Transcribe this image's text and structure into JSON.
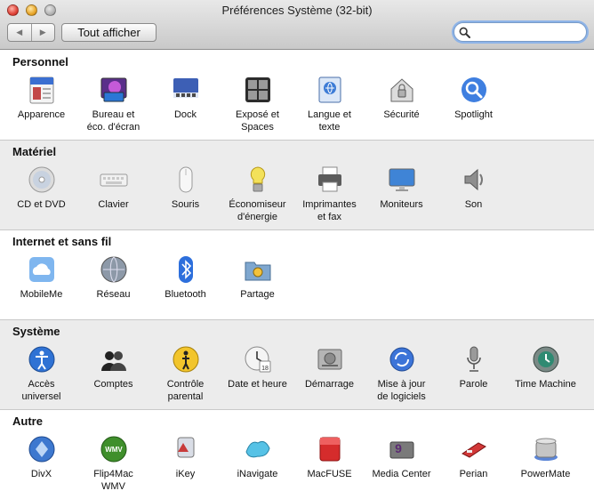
{
  "window": {
    "title": "Préférences Système (32-bit)"
  },
  "toolbar": {
    "back_label": "◀",
    "forward_label": "▶",
    "show_all_label": "Tout afficher",
    "search_value": "",
    "search_placeholder": ""
  },
  "sections": [
    {
      "title": "Personnel",
      "items": [
        {
          "label": "Apparence",
          "icon": "appearance-icon"
        },
        {
          "label": "Bureau et\néco. d'écran",
          "icon": "desktop-screensaver-icon"
        },
        {
          "label": "Dock",
          "icon": "dock-icon"
        },
        {
          "label": "Exposé et\nSpaces",
          "icon": "expose-spaces-icon"
        },
        {
          "label": "Langue et\ntexte",
          "icon": "language-text-icon"
        },
        {
          "label": "Sécurité",
          "icon": "security-icon"
        },
        {
          "label": "Spotlight",
          "icon": "spotlight-icon"
        }
      ]
    },
    {
      "title": "Matériel",
      "items": [
        {
          "label": "CD et DVD",
          "icon": "cd-dvd-icon"
        },
        {
          "label": "Clavier",
          "icon": "keyboard-icon"
        },
        {
          "label": "Souris",
          "icon": "mouse-icon"
        },
        {
          "label": "Économiseur\nd'énergie",
          "icon": "energy-saver-icon"
        },
        {
          "label": "Imprimantes\net fax",
          "icon": "printer-icon"
        },
        {
          "label": "Moniteurs",
          "icon": "monitor-icon"
        },
        {
          "label": "Son",
          "icon": "sound-icon"
        }
      ]
    },
    {
      "title": "Internet et sans fil",
      "items": [
        {
          "label": "MobileMe",
          "icon": "mobileme-icon"
        },
        {
          "label": "Réseau",
          "icon": "network-icon"
        },
        {
          "label": "Bluetooth",
          "icon": "bluetooth-icon"
        },
        {
          "label": "Partage",
          "icon": "sharing-icon"
        }
      ]
    },
    {
      "title": "Système",
      "items": [
        {
          "label": "Accès\nuniversel",
          "icon": "universal-access-icon"
        },
        {
          "label": "Comptes",
          "icon": "accounts-icon"
        },
        {
          "label": "Contrôle\nparental",
          "icon": "parental-controls-icon"
        },
        {
          "label": "Date et heure",
          "icon": "date-time-icon"
        },
        {
          "label": "Démarrage",
          "icon": "startup-disk-icon"
        },
        {
          "label": "Mise à jour\nde logiciels",
          "icon": "software-update-icon"
        },
        {
          "label": "Parole",
          "icon": "speech-icon"
        },
        {
          "label": "Time Machine",
          "icon": "time-machine-icon"
        }
      ]
    },
    {
      "title": "Autre",
      "items": [
        {
          "label": "DivX",
          "icon": "divx-icon"
        },
        {
          "label": "Flip4Mac\nWMV",
          "icon": "flip4mac-icon"
        },
        {
          "label": "iKey",
          "icon": "ikey-icon"
        },
        {
          "label": "iNavigate",
          "icon": "inavigate-icon"
        },
        {
          "label": "MacFUSE",
          "icon": "macfuse-icon"
        },
        {
          "label": "Media Center",
          "icon": "media-center-icon"
        },
        {
          "label": "Perian",
          "icon": "perian-icon"
        },
        {
          "label": "PowerMate",
          "icon": "powermate-icon"
        }
      ]
    }
  ]
}
